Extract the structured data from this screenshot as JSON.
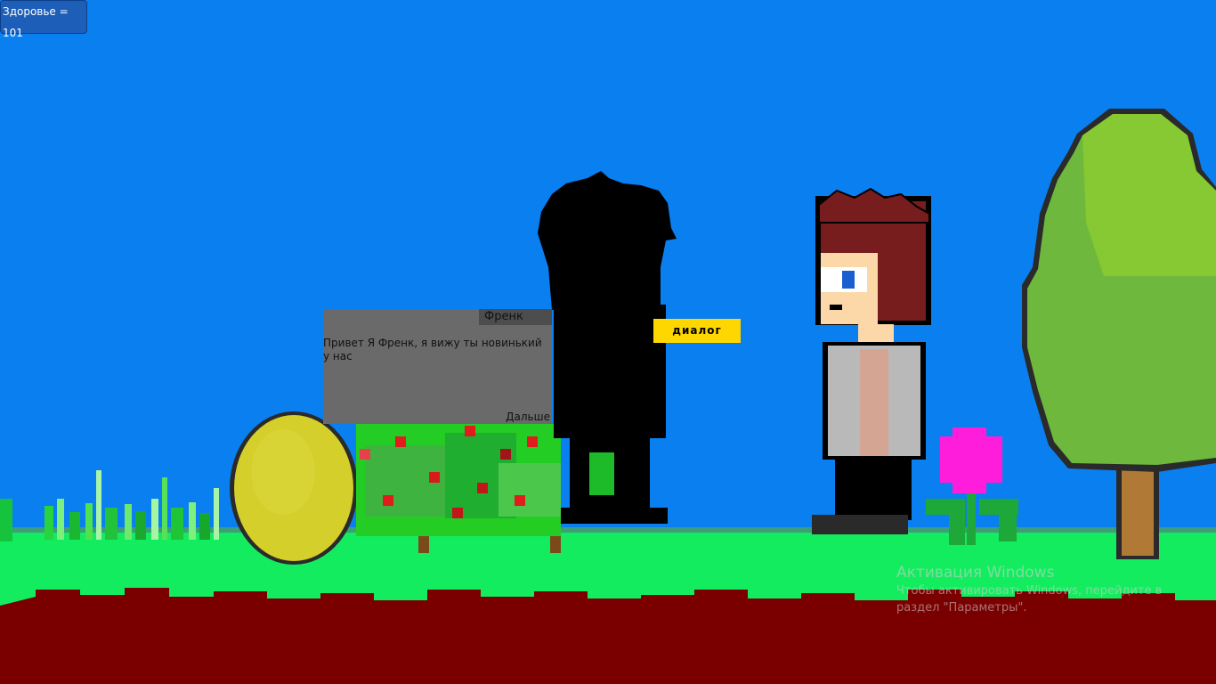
{
  "hud": {
    "health_label": "Здоровье = 101"
  },
  "dialog": {
    "speaker": "Френк",
    "text": "Привет Я Френк, я вижу ты новинький у нас",
    "next_label": "Дальше"
  },
  "interact": {
    "dialog_button": "диалог"
  },
  "watermark": {
    "title": "Активация Windows",
    "line1": "Чтобы активировать Windows, перейдите в",
    "line2": "раздел \"Параметры\"."
  },
  "colors": {
    "sky": "#0a7ff0",
    "grass": "#14ec5f",
    "soil": "#7a0000",
    "dialog_bg": "#6a6a6a",
    "dialog_button": "#ffd700",
    "health_bg": "#1d5fb8"
  },
  "icons": {
    "player": "player-sprite",
    "npc": "npc-silhouette",
    "egg": "egg",
    "bush": "berry-bush",
    "tree": "tree",
    "flower": "pink-flower",
    "grass": "grass-tuft"
  }
}
